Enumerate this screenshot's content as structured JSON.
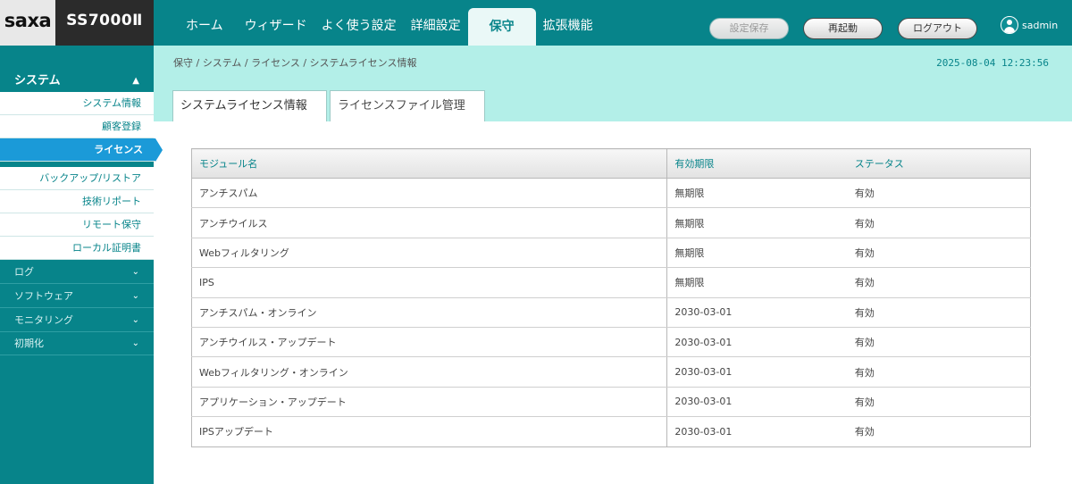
{
  "brand": {
    "logo": "saxa",
    "model": "SS7000Ⅱ"
  },
  "nav": [
    {
      "label": "ホーム"
    },
    {
      "label": "ウィザード"
    },
    {
      "label": "よく使う設定"
    },
    {
      "label": "詳細設定"
    },
    {
      "label": "保守",
      "active": true
    },
    {
      "label": "拡張機能"
    }
  ],
  "header_buttons": {
    "save": "設定保存",
    "reboot": "再起動",
    "logout": "ログアウト"
  },
  "user": {
    "name": "sadmin"
  },
  "sidebar": {
    "section": "システム",
    "items": [
      {
        "label": "システム情報"
      },
      {
        "label": "顧客登録"
      },
      {
        "label": "ライセンス",
        "active": true
      },
      {
        "label": "バックアップ/リストア"
      },
      {
        "label": "技術リポート"
      },
      {
        "label": "リモート保守"
      },
      {
        "label": "ローカル証明書"
      }
    ],
    "categories": [
      {
        "label": "ログ"
      },
      {
        "label": "ソフトウェア"
      },
      {
        "label": "モニタリング"
      },
      {
        "label": "初期化"
      }
    ]
  },
  "breadcrumb": "保守 / システム / ライセンス / システムライセンス情報",
  "datetime": "2025-08-04 12:23:56",
  "tabs": [
    {
      "label": "システムライセンス情報",
      "active": true
    },
    {
      "label": "ライセンスファイル管理"
    }
  ],
  "table": {
    "headers": [
      "モジュール名",
      "有効期限",
      "ステータス"
    ],
    "rows": [
      [
        "アンチスパム",
        "無期限",
        "有効"
      ],
      [
        "アンチウイルス",
        "無期限",
        "有効"
      ],
      [
        "Webフィルタリング",
        "無期限",
        "有効"
      ],
      [
        "IPS",
        "無期限",
        "有効"
      ],
      [
        "アンチスパム・オンライン",
        "2030-03-01",
        "有効"
      ],
      [
        "アンチウイルス・アップデート",
        "2030-03-01",
        "有効"
      ],
      [
        "Webフィルタリング・オンライン",
        "2030-03-01",
        "有効"
      ],
      [
        "アプリケーション・アップデート",
        "2030-03-01",
        "有効"
      ],
      [
        "IPSアップデート",
        "2030-03-01",
        "有効"
      ]
    ]
  },
  "colors": {
    "teal": "#07848a",
    "light_teal": "#b3efe8",
    "active_blue": "#1b9ad8"
  }
}
